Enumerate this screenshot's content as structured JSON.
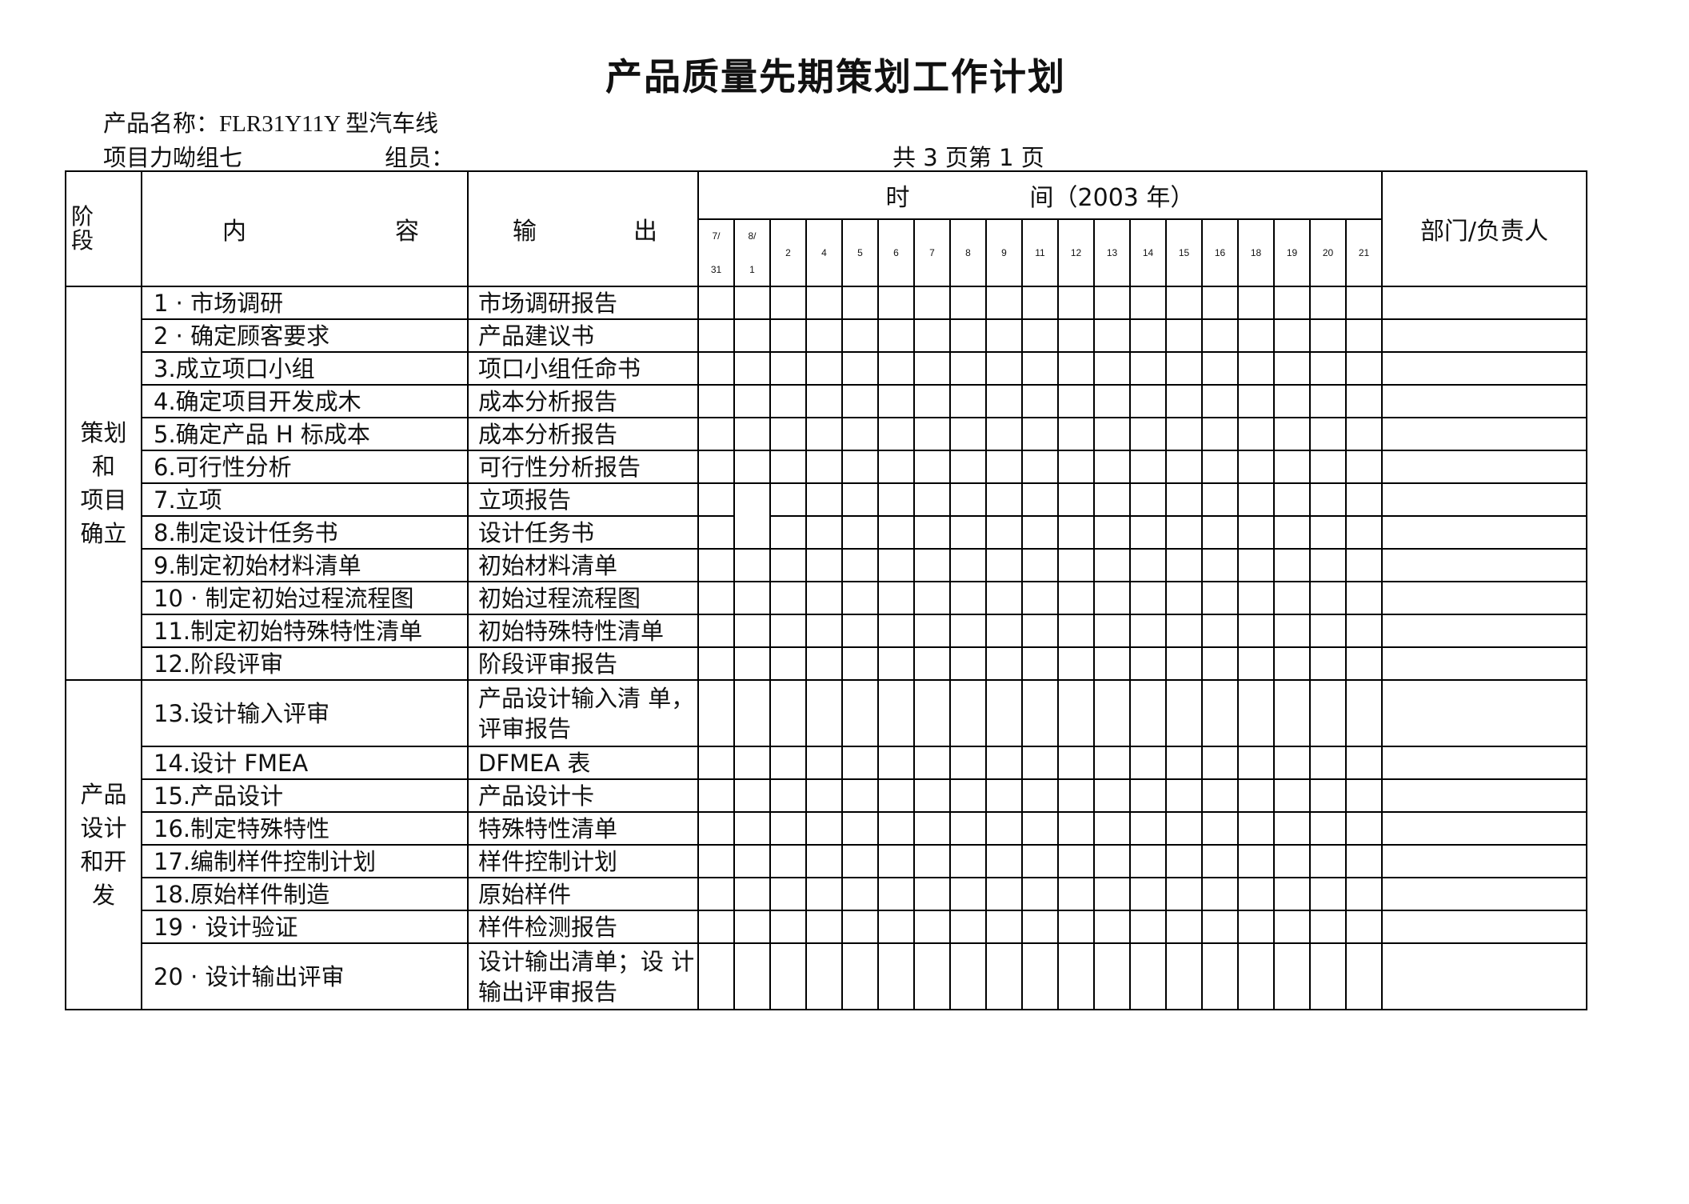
{
  "document": {
    "title": "产品质量先期策划工作计划",
    "product_name_label": "产品名称：",
    "product_name_value": "FLR31Y11Y 型汽车线",
    "team_label": "项目力呦组七",
    "members_label": "组员：",
    "members_value": "",
    "page_info": "共 3 页第 1 页"
  },
  "table": {
    "headers": {
      "stage": "阶段",
      "content_left": "内",
      "content_right": "容",
      "output_left": "输",
      "output_right": "出",
      "time_left": "时",
      "time_right": "间（2003 年）",
      "dept": "部门/负责人"
    },
    "weeks": [
      {
        "top": "7/",
        "bottom": "31"
      },
      {
        "top": "8/",
        "bottom": "1"
      },
      {
        "top": "2",
        "bottom": ""
      },
      {
        "top": "4",
        "bottom": ""
      },
      {
        "top": "5",
        "bottom": ""
      },
      {
        "top": "6",
        "bottom": ""
      },
      {
        "top": "7",
        "bottom": ""
      },
      {
        "top": "8",
        "bottom": ""
      },
      {
        "top": "9",
        "bottom": ""
      },
      {
        "top": "11",
        "bottom": ""
      },
      {
        "top": "12",
        "bottom": ""
      },
      {
        "top": "13",
        "bottom": ""
      },
      {
        "top": "14",
        "bottom": ""
      },
      {
        "top": "15",
        "bottom": ""
      },
      {
        "top": "16",
        "bottom": ""
      },
      {
        "top": "18",
        "bottom": ""
      },
      {
        "top": "19",
        "bottom": ""
      },
      {
        "top": "20",
        "bottom": ""
      },
      {
        "top": "21",
        "bottom": ""
      }
    ],
    "sections": [
      {
        "stage_lines": [
          "策划",
          "和",
          "项目",
          "确立"
        ],
        "rows": [
          {
            "content": "1 · 市场调研",
            "output": "市场调研报告"
          },
          {
            "content": "2 · 确定顾客要求",
            "output": "产品建议书"
          },
          {
            "content": "3.成立项口小组",
            "output": "项口小组任命书"
          },
          {
            "content": "4.确定项目开发成木",
            "output": "成本分析报告"
          },
          {
            "content": "5.确定产品 H 标成本",
            "output": "成本分析报告"
          },
          {
            "content": "6.可行性分析",
            "output": "可行性分析报告"
          },
          {
            "content": "7.立项",
            "output": "立项报告"
          },
          {
            "content": "8.制定设计任务书",
            "output": "设计任务书"
          },
          {
            "content": "9.制定初始材料清单",
            "output": "初始材料清单"
          },
          {
            "content": "10 · 制定初始过程流程图",
            "output": "初始过程流程图"
          },
          {
            "content": "11.制定初始特殊特性清单",
            "output": "初始特殊特性清单"
          },
          {
            "content": "12.阶段评审",
            "output": "阶段评审报告"
          }
        ]
      },
      {
        "stage_lines": [
          "产品",
          "设计",
          "和开",
          "发"
        ],
        "rows": [
          {
            "content": "13.设计输入评审",
            "output": "产品设计输入清 单，评审报告",
            "tall": true
          },
          {
            "content": "14.设计  FMEA",
            "output": "DFMEA 表"
          },
          {
            "content": "15.产品设计",
            "output": "产品设计卡"
          },
          {
            "content": "16.制定特殊特性",
            "output": "特殊特性清单"
          },
          {
            "content": "17.编制样件控制计划",
            "output": "样件控制计划"
          },
          {
            "content": "18.原始样件制造",
            "output": "原始样件"
          },
          {
            "content": "19 · 设计验证",
            "output": "样件检测报告"
          },
          {
            "content": "20 · 设计输出评审",
            "output": "设计输出清单；设 计输出评审报告",
            "tall": true
          }
        ]
      }
    ],
    "merged_week_cells": [
      {
        "section": 0,
        "row": 6,
        "week_index": 1,
        "rowspan": 2
      }
    ]
  }
}
